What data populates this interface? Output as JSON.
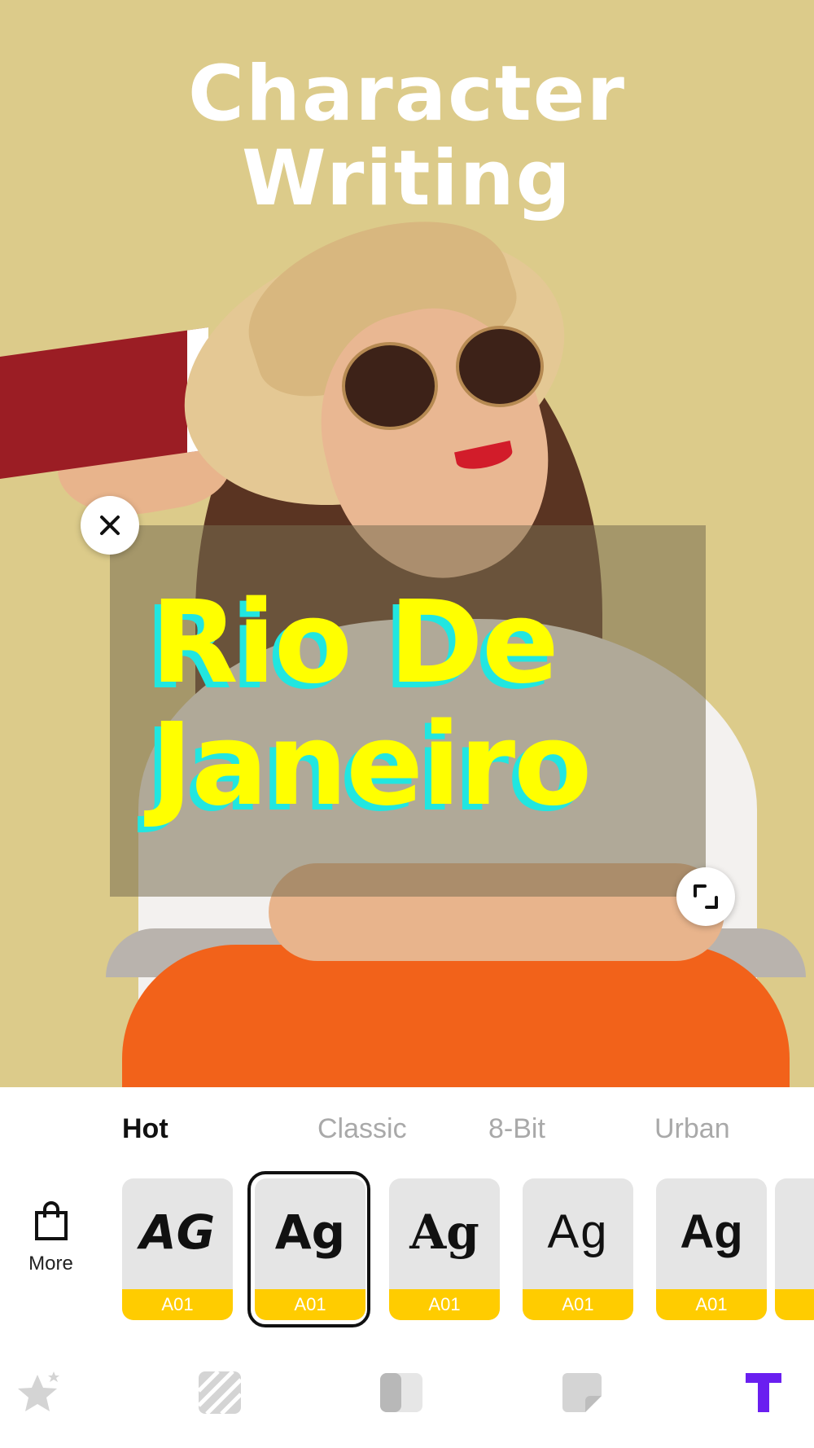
{
  "headline": {
    "line1": "Character",
    "line2": "Writing"
  },
  "text_overlay": {
    "line1": "Rio De",
    "line2": "Janeiro"
  },
  "tabs": [
    {
      "label": "Hot",
      "active": true
    },
    {
      "label": "Classic",
      "active": false
    },
    {
      "label": "8-Bit",
      "active": false
    },
    {
      "label": "Urban",
      "active": false
    }
  ],
  "more": {
    "label": "More",
    "icon": "shopping-bag-icon"
  },
  "font_cards": [
    {
      "glyph": "AG",
      "code": "A01"
    },
    {
      "glyph": "Ag",
      "code": "A01",
      "selected": true
    },
    {
      "glyph": "Ag",
      "code": "A01"
    },
    {
      "glyph": "Ag",
      "code": "A01"
    },
    {
      "glyph": "Ag",
      "code": "A01"
    }
  ],
  "toolbar": [
    {
      "icon": "star-sticker-icon"
    },
    {
      "icon": "pattern-icon"
    },
    {
      "icon": "filter-icon"
    },
    {
      "icon": "sticker-icon"
    },
    {
      "icon": "text-icon",
      "active": true
    }
  ],
  "colors": {
    "canvas_bg": "#dccb8a",
    "text_fill": "#ffff00",
    "text_shadow": "#21e6e0",
    "card_label_bg": "#ffcc00",
    "active_tool": "#6a1ff0",
    "inactive_tool": "#d4d4d4"
  }
}
